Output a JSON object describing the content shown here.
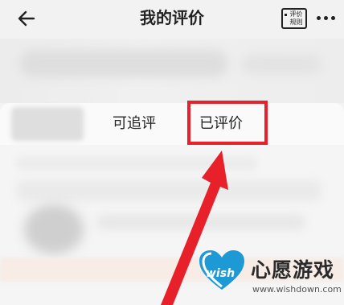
{
  "header": {
    "title": "我的评价",
    "rules_label_line1": "评价",
    "rules_label_line2": "规则",
    "back_icon": "arrow-left-icon",
    "more_icon": "more-dots-icon"
  },
  "tabs": [
    {
      "label": "可追评",
      "selected": false
    },
    {
      "label": "已评价",
      "selected": true
    }
  ],
  "colors": {
    "highlight": "#e8202a",
    "arrow": "#e8202a",
    "watermark_blue": "#1d9ad6"
  },
  "watermark": {
    "logo_text": "wish",
    "brand": "心愿游戏",
    "url": "www.wishdown.com"
  }
}
